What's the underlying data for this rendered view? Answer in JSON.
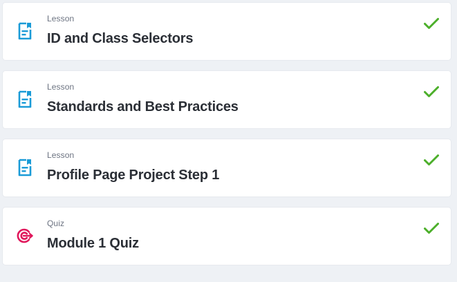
{
  "colors": {
    "background": "#eef1f5",
    "card": "#ffffff",
    "lesson_icon": "#1a9bd7",
    "quiz_icon": "#e0185c",
    "complete_check": "#4caf2a",
    "title_text": "#2b2f36",
    "kind_text": "#6b7280"
  },
  "items": [
    {
      "kind": "Lesson",
      "title": "ID and Class Selectors",
      "icon": "lesson-document-icon",
      "completed": true
    },
    {
      "kind": "Lesson",
      "title": "Standards and Best Practices",
      "icon": "lesson-document-icon",
      "completed": true
    },
    {
      "kind": "Lesson",
      "title": "Profile Page Project Step 1",
      "icon": "lesson-document-icon",
      "completed": true
    },
    {
      "kind": "Quiz",
      "title": "Module 1 Quiz",
      "icon": "quiz-target-icon",
      "completed": true
    }
  ]
}
